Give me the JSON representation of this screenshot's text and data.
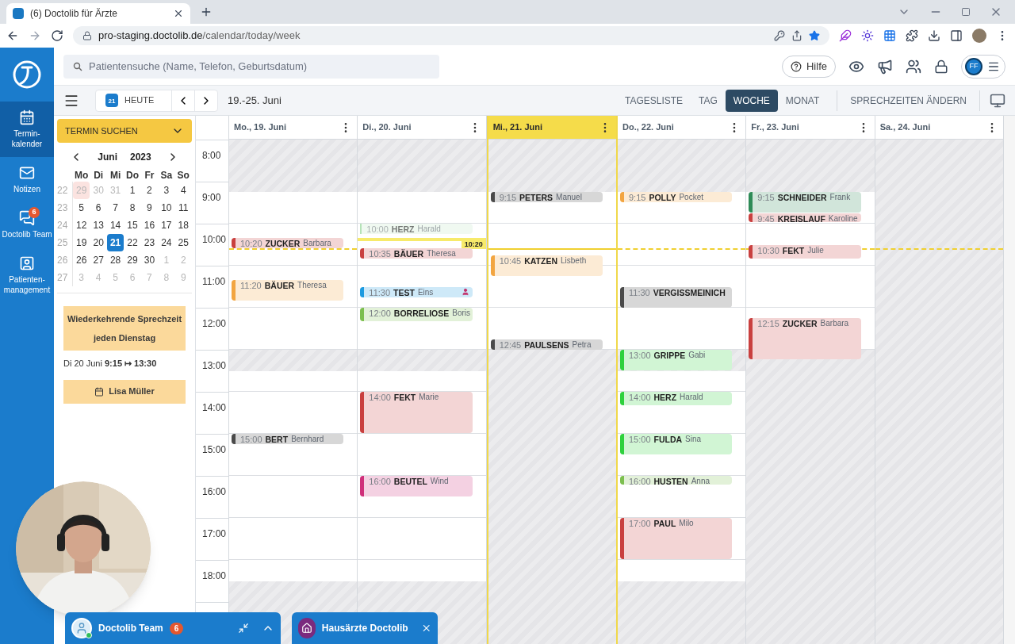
{
  "browser": {
    "tab_title": "(6) Doctolib für Ärzte",
    "url_domain": "pro-staging.doctolib.de",
    "url_path": "/calendar/today/week"
  },
  "sidebar": {
    "items": [
      {
        "kind": "calendar",
        "label": "Termin-kalender",
        "selected": true
      },
      {
        "kind": "notes",
        "label": "Notizen",
        "selected": false
      },
      {
        "kind": "team",
        "label": "Doctolib Team",
        "badge": "6",
        "selected": false
      },
      {
        "kind": "patients",
        "label": "Patienten-management",
        "selected": false
      }
    ]
  },
  "header": {
    "search_placeholder": "Patientensuche (Name, Telefon, Geburtsdatum)",
    "help": "Hilfe",
    "avatar_initials": "FF"
  },
  "toolbar": {
    "today_icon_day": "21",
    "today": "HEUTE",
    "range": "19.-25. Juni",
    "views": [
      {
        "label": "TAGESLISTE",
        "selected": false
      },
      {
        "label": "TAG",
        "selected": false
      },
      {
        "label": "WOCHE",
        "selected": true
      },
      {
        "label": "MONAT",
        "selected": false
      }
    ],
    "action": "SPRECHZEITEN ÄNDERN"
  },
  "left_panel": {
    "search_button": "TERMIN SUCHEN",
    "mini_calendar": {
      "month": "Juni",
      "year": "2023",
      "weekdays": [
        "Mo",
        "Di",
        "Mi",
        "Do",
        "Fr",
        "Sa",
        "So"
      ],
      "weeks": [
        {
          "number": "22",
          "days": [
            {
              "label": "29",
              "outside": true,
              "selected": false,
              "highlighted": true
            },
            {
              "label": "30",
              "outside": true,
              "selected": false,
              "highlighted": false
            },
            {
              "label": "31",
              "outside": true,
              "selected": false,
              "highlighted": false
            },
            {
              "label": "1",
              "outside": false,
              "selected": false,
              "highlighted": false
            },
            {
              "label": "2",
              "outside": false,
              "selected": false,
              "highlighted": false
            },
            {
              "label": "3",
              "outside": false,
              "selected": false,
              "highlighted": false
            },
            {
              "label": "4",
              "outside": false,
              "selected": false,
              "highlighted": false
            }
          ]
        },
        {
          "number": "23",
          "days": [
            {
              "label": "5",
              "outside": false,
              "selected": false,
              "highlighted": false
            },
            {
              "label": "6",
              "outside": false,
              "selected": false,
              "highlighted": false
            },
            {
              "label": "7",
              "outside": false,
              "selected": false,
              "highlighted": false
            },
            {
              "label": "8",
              "outside": false,
              "selected": false,
              "highlighted": false
            },
            {
              "label": "9",
              "outside": false,
              "selected": false,
              "highlighted": false
            },
            {
              "label": "10",
              "outside": false,
              "selected": false,
              "highlighted": false
            },
            {
              "label": "11",
              "outside": false,
              "selected": false,
              "highlighted": false
            }
          ]
        },
        {
          "number": "24",
          "days": [
            {
              "label": "12",
              "outside": false,
              "selected": false,
              "highlighted": false
            },
            {
              "label": "13",
              "outside": false,
              "selected": false,
              "highlighted": false
            },
            {
              "label": "14",
              "outside": false,
              "selected": false,
              "highlighted": false
            },
            {
              "label": "15",
              "outside": false,
              "selected": false,
              "highlighted": false
            },
            {
              "label": "16",
              "outside": false,
              "selected": false,
              "highlighted": false
            },
            {
              "label": "17",
              "outside": false,
              "selected": false,
              "highlighted": false
            },
            {
              "label": "18",
              "outside": false,
              "selected": false,
              "highlighted": false
            }
          ]
        },
        {
          "number": "25",
          "days": [
            {
              "label": "19",
              "outside": false,
              "selected": false,
              "highlighted": false
            },
            {
              "label": "20",
              "outside": false,
              "selected": false,
              "highlighted": false
            },
            {
              "label": "21",
              "outside": false,
              "selected": true,
              "highlighted": false
            },
            {
              "label": "22",
              "outside": false,
              "selected": false,
              "highlighted": false
            },
            {
              "label": "23",
              "outside": false,
              "selected": false,
              "highlighted": false
            },
            {
              "label": "24",
              "outside": false,
              "selected": false,
              "highlighted": false
            },
            {
              "label": "25",
              "outside": false,
              "selected": false,
              "highlighted": false
            }
          ]
        },
        {
          "number": "26",
          "days": [
            {
              "label": "26",
              "outside": false,
              "selected": false,
              "highlighted": false
            },
            {
              "label": "27",
              "outside": false,
              "selected": false,
              "highlighted": false
            },
            {
              "label": "28",
              "outside": false,
              "selected": false,
              "highlighted": false
            },
            {
              "label": "29",
              "outside": false,
              "selected": false,
              "highlighted": false
            },
            {
              "label": "30",
              "outside": false,
              "selected": false,
              "highlighted": false
            },
            {
              "label": "1",
              "outside": true,
              "selected": false,
              "highlighted": false
            },
            {
              "label": "2",
              "outside": true,
              "selected": false,
              "highlighted": false
            }
          ]
        },
        {
          "number": "27",
          "days": [
            {
              "label": "3",
              "outside": true,
              "selected": false,
              "highlighted": false
            },
            {
              "label": "4",
              "outside": true,
              "selected": false,
              "highlighted": false
            },
            {
              "label": "5",
              "outside": true,
              "selected": false,
              "highlighted": false
            },
            {
              "label": "6",
              "outside": true,
              "selected": false,
              "highlighted": false
            },
            {
              "label": "7",
              "outside": true,
              "selected": false,
              "highlighted": false
            },
            {
              "label": "8",
              "outside": true,
              "selected": false,
              "highlighted": false
            },
            {
              "label": "9",
              "outside": true,
              "selected": false,
              "highlighted": false
            }
          ]
        }
      ]
    },
    "recurring": {
      "title_lines": [
        "Wiederkehrende Sprechzeit",
        "jeden Dienstag"
      ],
      "schedule": "Di 20 Juni **9:15 ↦ 13:30**",
      "person": "Lisa Müller"
    }
  },
  "calendar": {
    "hours": [
      "8:00",
      "9:00",
      "10:00",
      "11:00",
      "12:00",
      "13:00",
      "14:00",
      "15:00",
      "16:00",
      "17:00",
      "18:00"
    ],
    "now": {
      "label": "10:20"
    },
    "days": [
      {
        "label": "Mo., 19. Juni",
        "selected": false,
        "closed_periods": [
          {
            "kind": "morning"
          },
          {
            "kind": "lunch"
          },
          {
            "kind": "evening"
          }
        ],
        "appointments": [
          {
            "time": "10:20",
            "surname": "ZUCKER",
            "first_name": "Barbara",
            "color": "#c9403f",
            "kind": "short",
            "dimmed": false,
            "person_marker": false
          },
          {
            "time": "11:20",
            "surname": "BÄUER",
            "first_name": "Theresa",
            "color": "#f2a541",
            "kind": "half",
            "dimmed": false,
            "person_marker": false
          },
          {
            "time": "15:00",
            "surname": "BERT",
            "first_name": "Bernhard",
            "color": "#4a4a4a",
            "kind": "short",
            "dimmed": false,
            "person_marker": false
          }
        ]
      },
      {
        "label": "Di., 20. Juni",
        "selected": false,
        "closed_periods": [
          {
            "kind": "morning"
          },
          {
            "kind": "lunch"
          },
          {
            "kind": "evening"
          }
        ],
        "appointments": [
          {
            "time": "10:00",
            "surname": "HERZ",
            "first_name": "Harald",
            "color": "#b5e3b8",
            "kind": "short",
            "dimmed": true,
            "person_marker": false
          },
          {
            "time": "10:35",
            "surname": "BÄUER",
            "first_name": "Theresa",
            "color": "#c9403f",
            "kind": "short",
            "dimmed": false,
            "person_marker": false
          },
          {
            "time": "11:30",
            "surname": "TEST",
            "first_name": "Eins",
            "color": "#1e9be0",
            "kind": "short",
            "dimmed": false,
            "person_marker": true
          },
          {
            "time": "12:00",
            "surname": "BORRELIOSE",
            "first_name": "Boris",
            "color": "#7cbf4f",
            "kind": "medium",
            "dimmed": false,
            "person_marker": false
          },
          {
            "time": "14:00",
            "surname": "FEKT",
            "first_name": "Marie",
            "color": "#c9403f",
            "kind": "hour",
            "dimmed": false,
            "person_marker": false
          },
          {
            "time": "16:00",
            "surname": "BEUTEL",
            "first_name": "Wind",
            "color": "#cf2f7a",
            "kind": "half",
            "dimmed": false,
            "person_marker": false
          }
        ]
      },
      {
        "label": "Mi., 21. Juni",
        "selected": true,
        "closed_periods": [
          {
            "kind": "morning"
          },
          {
            "kind": "afternoon"
          }
        ],
        "appointments": [
          {
            "time": "9:15",
            "surname": "PETERS",
            "first_name": "Manuel",
            "color": "#4a4a4a",
            "kind": "short",
            "dimmed": false,
            "person_marker": false
          },
          {
            "time": "10:45",
            "surname": "KATZEN",
            "first_name": "Lisbeth",
            "color": "#f2a541",
            "kind": "half",
            "dimmed": false,
            "person_marker": false
          },
          {
            "time": "12:45",
            "surname": "PAULSENS",
            "first_name": "Petra",
            "color": "#4a4a4a",
            "kind": "short",
            "dimmed": false,
            "person_marker": false
          }
        ]
      },
      {
        "label": "Do., 22. Juni",
        "selected": false,
        "closed_periods": [
          {
            "kind": "morning"
          },
          {
            "kind": "lunch"
          },
          {
            "kind": "evening"
          }
        ],
        "appointments": [
          {
            "time": "9:15",
            "surname": "POLLY",
            "first_name": "Pocket",
            "color": "#f2a541",
            "kind": "short",
            "dimmed": false,
            "person_marker": false
          },
          {
            "time": "11:30",
            "surname": "VERGISSMEINICH",
            "color": "#4a4a4a",
            "kind": "half",
            "dimmed": false,
            "person_marker": false
          },
          {
            "time": "13:00",
            "surname": "GRIPPE",
            "first_name": "Gabi",
            "color": "#2ed13d",
            "kind": "half",
            "dimmed": false,
            "person_marker": false
          },
          {
            "time": "14:00",
            "surname": "HERZ",
            "first_name": "Harald",
            "color": "#2ed13d",
            "kind": "medium",
            "dimmed": false,
            "person_marker": false
          },
          {
            "time": "15:00",
            "surname": "FULDA",
            "first_name": "Sina",
            "color": "#2ed13d",
            "kind": "half",
            "dimmed": false,
            "person_marker": false
          },
          {
            "time": "16:00",
            "surname": "HUSTEN",
            "first_name": "Anna",
            "color": "#7cbf4f",
            "kind": "xs",
            "dimmed": false,
            "person_marker": false
          },
          {
            "time": "17:00",
            "surname": "PAUL",
            "first_name": "Milo",
            "color": "#c9403f",
            "kind": "hour",
            "dimmed": false,
            "person_marker": false
          }
        ]
      },
      {
        "label": "Fr., 23. Juni",
        "selected": false,
        "closed_periods": [
          {
            "kind": "morning"
          },
          {
            "kind": "afternoon"
          }
        ],
        "appointments": [
          {
            "time": "9:15",
            "surname": "SCHNEIDER",
            "first_name": "Frank",
            "color": "#2e8b57",
            "kind": "half",
            "dimmed": false,
            "person_marker": false
          },
          {
            "time": "9:45",
            "surname": "KREISLAUF",
            "first_name": "Karoline",
            "color": "#c9403f",
            "kind": "xs",
            "dimmed": false,
            "person_marker": false
          },
          {
            "time": "10:30",
            "surname": "FEKT",
            "first_name": "Julie",
            "color": "#c9403f",
            "kind": "medium",
            "dimmed": false,
            "person_marker": false
          },
          {
            "time": "12:15",
            "surname": "ZUCKER",
            "first_name": "Barbara",
            "color": "#c9403f",
            "kind": "hour",
            "dimmed": false,
            "person_marker": false
          }
        ]
      },
      {
        "label": "Sa., 24. Juni",
        "selected": false,
        "closed_periods": [
          {
            "kind": "all_day"
          }
        ]
      }
    ]
  },
  "chats": [
    {
      "kind": "team",
      "title": "Doctolib Team",
      "badge": "6"
    },
    {
      "kind": "group",
      "title": "Hausärzte Doctolib"
    }
  ]
}
